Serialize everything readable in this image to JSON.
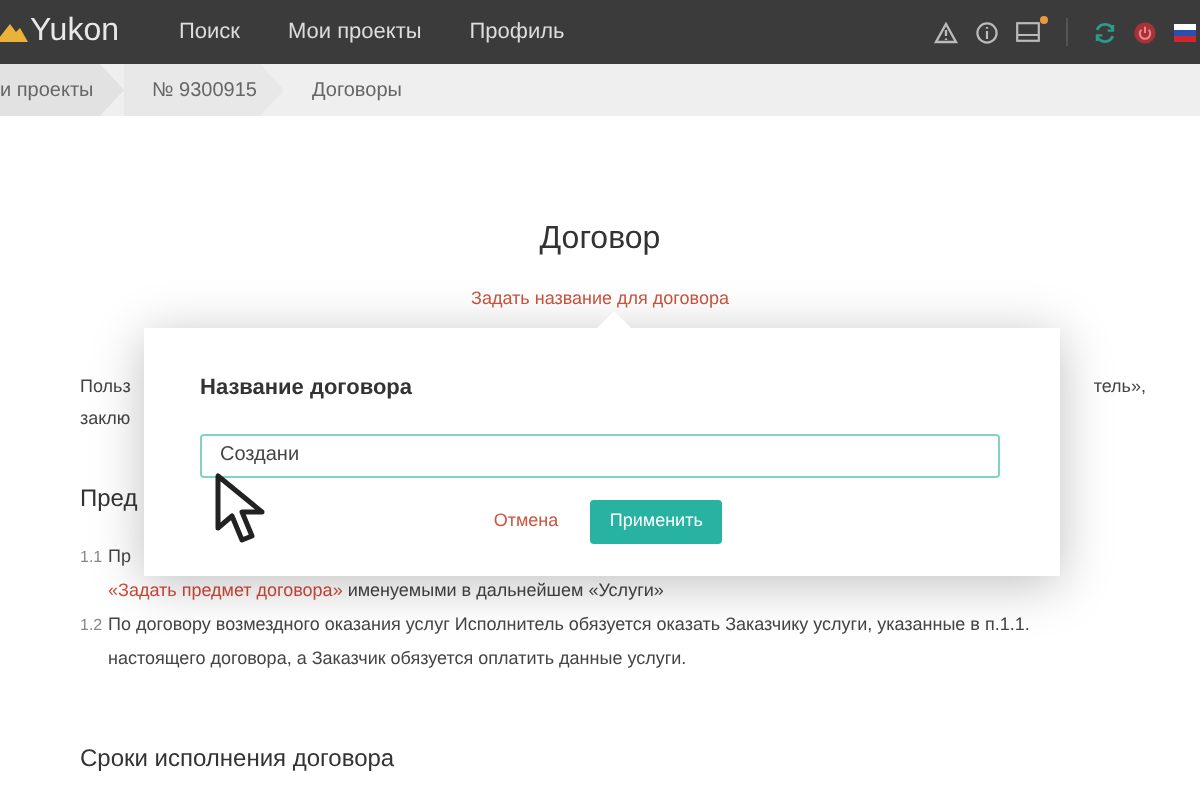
{
  "navbar": {
    "logo": "Yukon",
    "links": [
      "Поиск",
      "Мои проекты",
      "Профиль"
    ],
    "notification_dot": true
  },
  "breadcrumbs": [
    "и проекты",
    "№ 9300915",
    "Договоры"
  ],
  "document": {
    "title": "Договор",
    "title_link": "Задать название для договора",
    "intro_lines": [
      {
        "left": "Польз",
        "right": "тель»,"
      },
      {
        "left": "заклю"
      }
    ],
    "section_1_heading": "Пред",
    "clauses": [
      {
        "number": "1.1",
        "lines": [
          "Пр",
          "**«Задать предмет договора»** именуемыми в дальнейшем «Услуги»"
        ]
      },
      {
        "number": "1.2",
        "lines": [
          "По договору возмездного оказания услуг Исполнитель обязуется оказать Заказчику услуги, указанные в п.1.1.",
          "настоящего договора, а Заказчик обязуется оплатить данные услуги."
        ]
      }
    ],
    "section_2_heading": "Сроки исполнения договора"
  },
  "dialog": {
    "title": "Название договора",
    "input_value": "Создани",
    "cancel": "Отмена",
    "apply": "Применить"
  }
}
